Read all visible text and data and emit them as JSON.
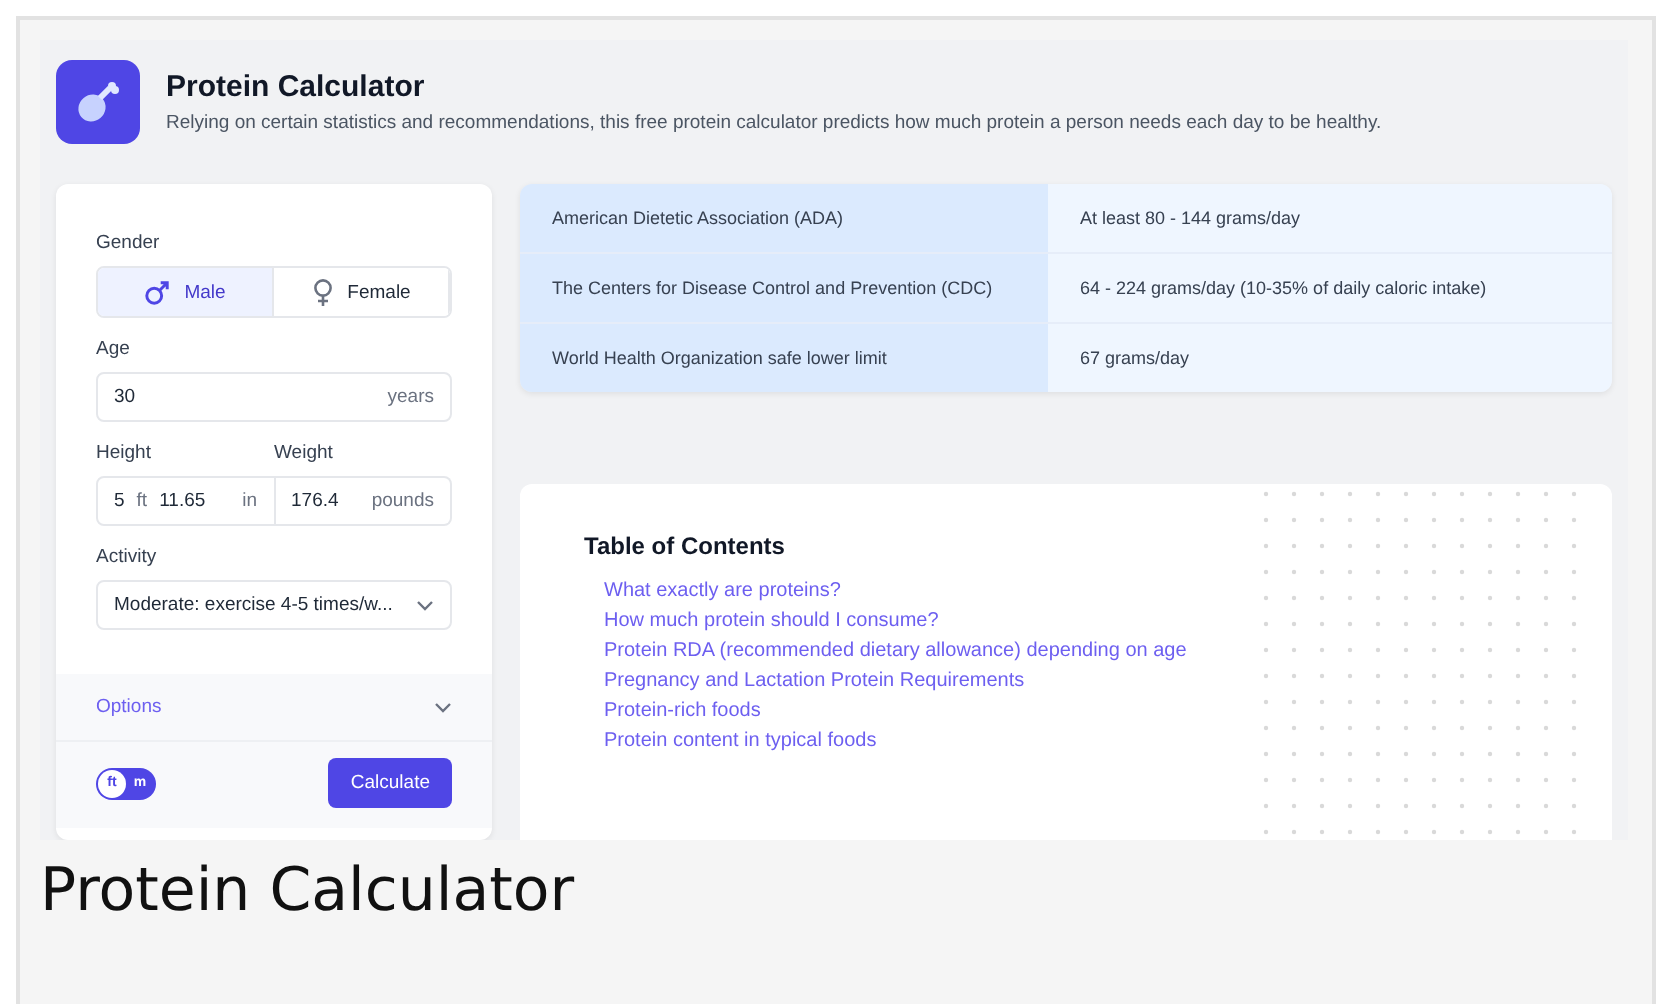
{
  "header": {
    "title": "Protein Calculator",
    "subtitle": "Relying on certain statistics and recommendations, this free protein calculator predicts how much protein a person needs each day to be healthy."
  },
  "form": {
    "gender": {
      "label": "Gender",
      "options": [
        {
          "label": "Male",
          "kind": "male",
          "selected": true
        },
        {
          "label": "Female",
          "kind": "female",
          "selected": false
        }
      ]
    },
    "age": {
      "label": "Age",
      "value": "30",
      "unit": "years"
    },
    "height": {
      "label": "Height",
      "feet": "5",
      "feet_unit": "ft",
      "inches": "11.65",
      "inches_unit": "in"
    },
    "weight": {
      "label": "Weight",
      "value": "176.4",
      "unit": "pounds"
    },
    "activity": {
      "label": "Activity",
      "value": "Moderate: exercise 4-5 times/w..."
    },
    "options": {
      "label": "Options",
      "expanded": false
    },
    "units": [
      {
        "label": "ft",
        "selected": true
      },
      {
        "label": "m",
        "selected": false
      }
    ],
    "button": "Calculate"
  },
  "recommendations": [
    {
      "source": "American Dietetic Association (ADA)",
      "amount": "At least 80 - 144 grams/day"
    },
    {
      "source": "The Centers for Disease Control and Prevention (CDC)",
      "amount": "64 - 224 grams/day (10-35% of daily caloric intake)"
    },
    {
      "source": "World Health Organization safe lower limit",
      "amount": "67 grams/day"
    }
  ],
  "toc": {
    "title": "Table of Contents",
    "items": [
      "What exactly are proteins?",
      "How much protein should I consume?",
      "Protein RDA (recommended dietary allowance) depending on age",
      "Pregnancy and Lactation Protein Requirements",
      "Protein-rich foods",
      "Protein content in typical foods"
    ]
  },
  "caption": "Protein Calculator"
}
